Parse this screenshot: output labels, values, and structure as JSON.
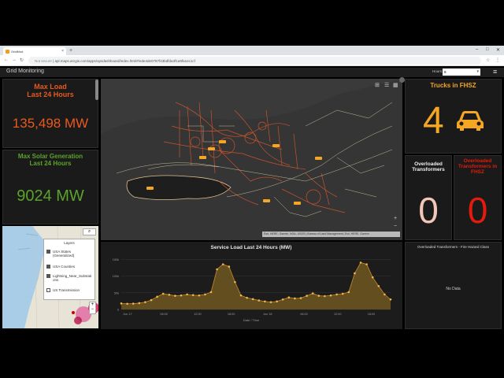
{
  "browser": {
    "tab_title": "GridMod",
    "new_tab": "+",
    "url": "apl.maps.arcgis.com/apps/opsdashboard/index.html#/ede4de0787f43bdfda3f1a9fa1ec1cf",
    "url_prefix": "Not secure",
    "back": "←",
    "forward": "→",
    "reload": "↻",
    "minimize": "–",
    "maximize": "□",
    "close": "✕"
  },
  "app": {
    "title": "Grid Monitoring",
    "hours_label": "Hours:",
    "hours_value": "8",
    "menu_icon": "hamburger-menu-icon"
  },
  "max_load": {
    "title_line1": "Max Load",
    "title_line2": "Last 24 Hours",
    "value": "135,498 MW",
    "color": "#e8591e"
  },
  "max_solar": {
    "title_line1": "Max Solar Generation",
    "title_line2": "Last 24 Hours",
    "value": "9024 MW",
    "color": "#5ba32b"
  },
  "trucks": {
    "title": "Trucks in FHSZ",
    "value": "4",
    "icon": "truck-icon",
    "color": "#f5a623"
  },
  "overloaded": {
    "title_line1": "Overloaded",
    "title_line2": "Transformers",
    "value": "0",
    "color": "#f3c7b8"
  },
  "overloaded_fhsz": {
    "title_line1": "Overloaded",
    "title_line2": "Transformers in",
    "title_line3": "FHSZ",
    "value": "0",
    "color": "#e31b0c"
  },
  "fire_hazard": {
    "title": "Overloaded Transformers - Fire Hazard Class",
    "empty_text": "No Data"
  },
  "map": {
    "attribution": "Esri, HERE, Garmin, NGA, USGS | Bureau of Land Management, Esri, HERE, Garmin",
    "zoom_in": "+",
    "zoom_out": "−"
  },
  "inset": {
    "layers_title": "Layers",
    "layers": [
      {
        "label": "USA States (Generalized)",
        "checked": true
      },
      {
        "label": "USA Counties",
        "checked": true
      },
      {
        "label": "Lightning_Near_Substations",
        "checked": true
      },
      {
        "label": "US Transmission",
        "checked": false
      }
    ]
  },
  "chart_data": {
    "type": "area",
    "title": "Service Load Last 24 Hours (MW)",
    "xlabel": "Date / Time",
    "ylabel": "",
    "ylim": [
      0,
      160000
    ],
    "y_ticks": [
      "150k",
      "100k",
      "50k",
      "0"
    ],
    "x_ticks": [
      "Jun 17",
      "06:00",
      "12:00",
      "18:00",
      "Jun 18",
      "06:00",
      "12:00",
      "18:00"
    ],
    "values": [
      18000,
      17000,
      17500,
      19000,
      22000,
      28000,
      38000,
      47000,
      44000,
      41000,
      42000,
      45000,
      43000,
      42000,
      45000,
      52000,
      120000,
      135000,
      128000,
      82000,
      42000,
      35000,
      31000,
      27000,
      24000,
      22000,
      24000,
      30000,
      36000,
      33000,
      34000,
      41000,
      48000,
      41000,
      40000,
      42000,
      45000,
      47000,
      52000,
      108000,
      140000,
      135000,
      96000,
      70000,
      45000,
      30000
    ],
    "color": "#c98a2b"
  }
}
